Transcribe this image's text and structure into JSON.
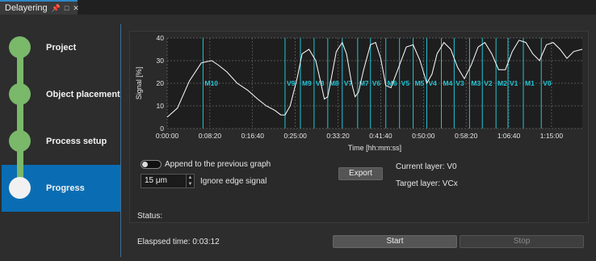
{
  "window": {
    "tab_title": "Delayering",
    "pin_icon": "pin-icon",
    "restore_icon": "restore-icon",
    "close_icon": "close-icon"
  },
  "steps": [
    {
      "label": "Project",
      "state": "done"
    },
    {
      "label": "Object placement",
      "state": "done"
    },
    {
      "label": "Process setup",
      "state": "done"
    },
    {
      "label": "Progress",
      "state": "active"
    }
  ],
  "colors": {
    "accent": "#0a6db3",
    "step_done": "#7ab86a",
    "marker": "#22c4d4",
    "curve": "#ffffff"
  },
  "chart_data": {
    "type": "line",
    "xlabel": "Time [hh:mm:ss]",
    "ylabel": "Signal [%]",
    "x_ticks": [
      "0:00:00",
      "0:08:20",
      "0:16:40",
      "0:25:00",
      "0:33:20",
      "0:41:40",
      "0:50:00",
      "0:58:20",
      "1:06:40",
      "1:15:00"
    ],
    "y_ticks": [
      "0",
      "10",
      "20",
      "30",
      "40"
    ],
    "xlim_s": [
      0,
      4860
    ],
    "ylim": [
      0,
      40
    ],
    "grid": true,
    "series": [
      {
        "x_s": [
          0,
          120,
          260,
          400,
          520,
          600,
          700,
          820,
          940,
          1060,
          1160,
          1260,
          1330,
          1380,
          1440,
          1520,
          1580,
          1660,
          1740,
          1800,
          1840,
          1880,
          1920,
          1980,
          2050,
          2100,
          2160,
          2200,
          2240,
          2300,
          2380,
          2440,
          2500,
          2560,
          2620,
          2720,
          2800,
          2880,
          2960,
          3040,
          3100,
          3160,
          3240,
          3320,
          3400,
          3480,
          3560,
          3640,
          3720,
          3800,
          3880,
          3960,
          4040,
          4120,
          4200,
          4280,
          4360,
          4440,
          4520,
          4600,
          4680,
          4760,
          4860
        ],
        "y": [
          5,
          9,
          21,
          29,
          30,
          28,
          25,
          20,
          17,
          13,
          10,
          8,
          6,
          6,
          10,
          22,
          33,
          35,
          30,
          20,
          13,
          14,
          22,
          34,
          38,
          33,
          20,
          14,
          16,
          26,
          37,
          38,
          31,
          19,
          18,
          28,
          36,
          37,
          30,
          20,
          24,
          33,
          38,
          35,
          27,
          22,
          28,
          36,
          38,
          33,
          26,
          26,
          34,
          39,
          38,
          33,
          30,
          37,
          38,
          35,
          31,
          34,
          35
        ]
      }
    ],
    "markers": [
      {
        "label": "M10",
        "x_s": 420
      },
      {
        "label": "V9",
        "x_s": 1380
      },
      {
        "label": "M9",
        "x_s": 1560
      },
      {
        "label": "V8",
        "x_s": 1720
      },
      {
        "label": "M8",
        "x_s": 1880
      },
      {
        "label": "V7",
        "x_s": 2050
      },
      {
        "label": "M7",
        "x_s": 2230
      },
      {
        "label": "V6",
        "x_s": 2380
      },
      {
        "label": "M6",
        "x_s": 2560
      },
      {
        "label": "V5",
        "x_s": 2720
      },
      {
        "label": "M5",
        "x_s": 2880
      },
      {
        "label": "V4",
        "x_s": 3040
      },
      {
        "label": "M4",
        "x_s": 3210
      },
      {
        "label": "V3",
        "x_s": 3360
      },
      {
        "label": "M3",
        "x_s": 3540
      },
      {
        "label": "V2",
        "x_s": 3690
      },
      {
        "label": "M2",
        "x_s": 3850
      },
      {
        "label": "V1",
        "x_s": 3990
      },
      {
        "label": "M1",
        "x_s": 4170
      },
      {
        "label": "V0",
        "x_s": 4380
      }
    ]
  },
  "controls": {
    "append_label": "Append to the previous graph",
    "thickness_value": "15 μm",
    "ignore_edge_label": "Ignore edge signal",
    "export_label": "Export",
    "current_layer": "Current layer: V0",
    "target_layer": "Target  layer: VCx",
    "status_label": "Status:"
  },
  "footer": {
    "elapsed": "Elaspsed time: 0:03:12",
    "start_label": "Start",
    "stop_label": "Stop"
  }
}
